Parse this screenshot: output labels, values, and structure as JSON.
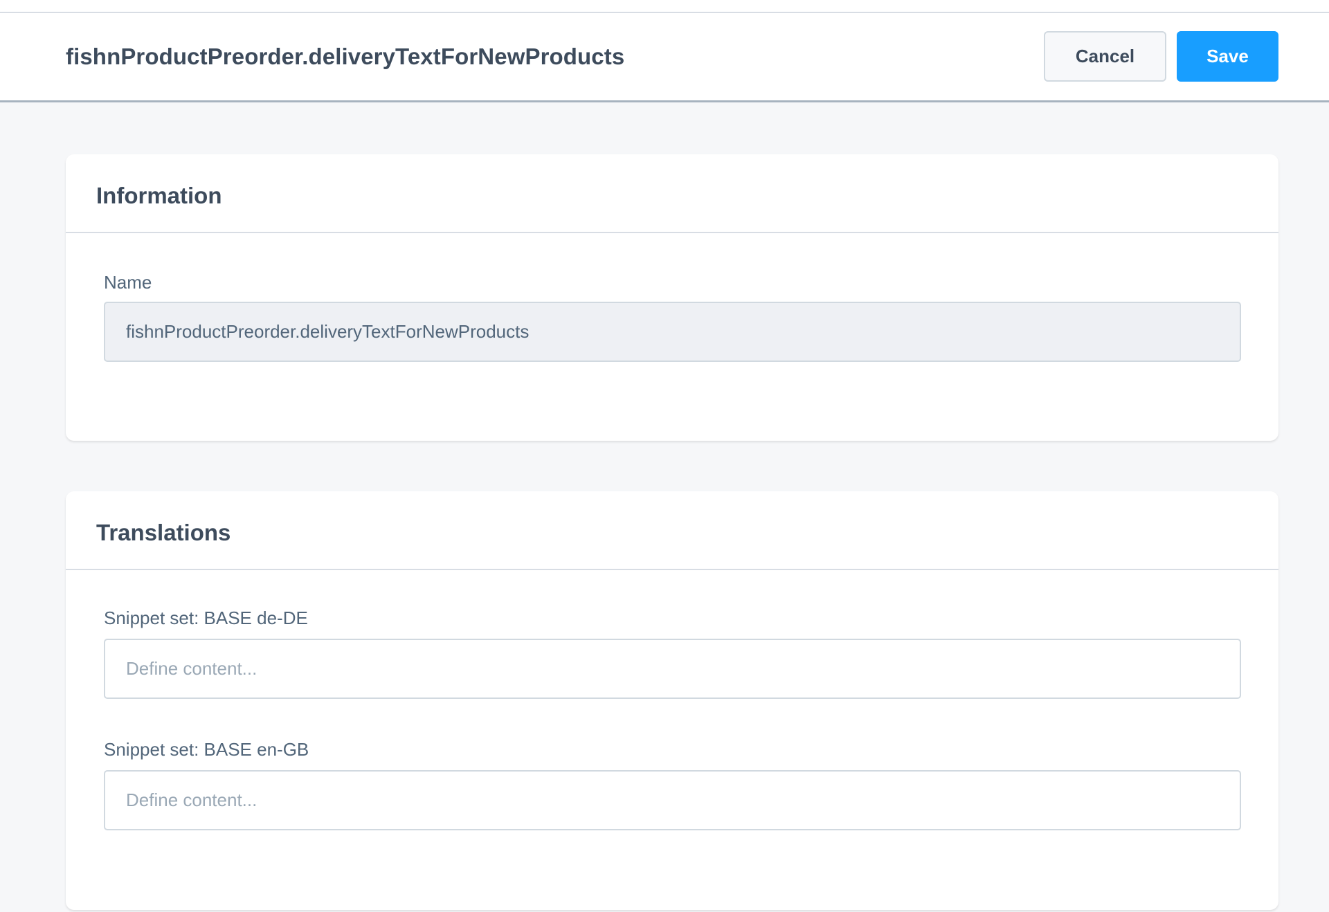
{
  "header": {
    "title": "fishnProductPreorder.deliveryTextForNewProducts",
    "cancel_label": "Cancel",
    "save_label": "Save"
  },
  "information": {
    "title": "Information",
    "name_label": "Name",
    "name_value": "fishnProductPreorder.deliveryTextForNewProducts"
  },
  "translations": {
    "title": "Translations",
    "fields": [
      {
        "label": "Snippet set: BASE de-DE",
        "value": "",
        "placeholder": "Define content..."
      },
      {
        "label": "Snippet set: BASE en-GB",
        "value": "",
        "placeholder": "Define content..."
      }
    ]
  },
  "colors": {
    "primary": "#189eff",
    "background": "#f6f7f9",
    "text": "#3d4b5c"
  }
}
